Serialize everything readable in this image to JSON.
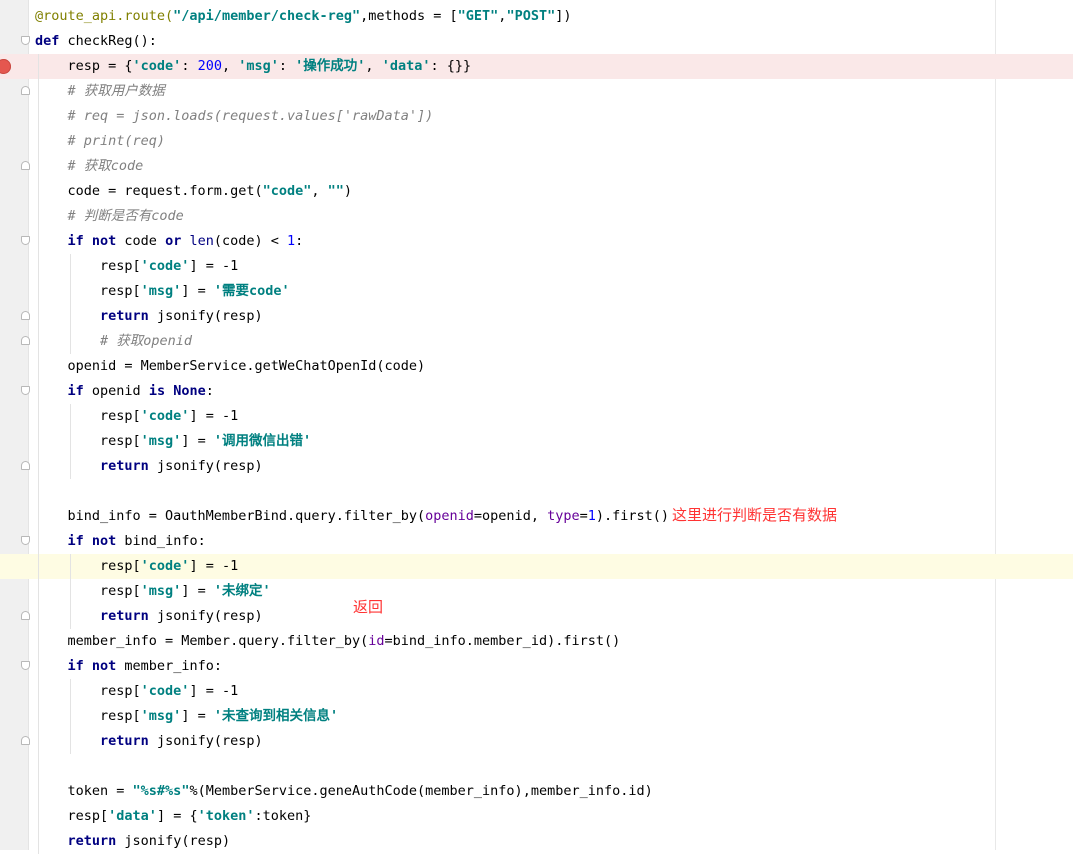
{
  "editor": {
    "lines": [
      [
        [
          "deco",
          "@route_api.route("
        ],
        [
          "str",
          "\"/api/member/check-reg\""
        ],
        [
          "plain",
          ",methods = ["
        ],
        [
          "str",
          "\"GET\""
        ],
        [
          "plain",
          ","
        ],
        [
          "str",
          "\"POST\""
        ],
        [
          "plain",
          "])"
        ]
      ],
      [
        [
          "kw",
          "def"
        ],
        [
          "plain",
          " checkReg():"
        ]
      ],
      [
        [
          "plain",
          "    resp = {"
        ],
        [
          "str",
          "'code'"
        ],
        [
          "plain",
          ": "
        ],
        [
          "num",
          "200"
        ],
        [
          "plain",
          ", "
        ],
        [
          "str",
          "'msg'"
        ],
        [
          "plain",
          ": "
        ],
        [
          "str",
          "'操作成功'"
        ],
        [
          "plain",
          ", "
        ],
        [
          "str",
          "'data'"
        ],
        [
          "plain",
          ": {}}"
        ]
      ],
      [
        [
          "cm",
          "    # 获取用户数据"
        ]
      ],
      [
        [
          "cm",
          "    # req = json.loads(request.values['rawData'])"
        ]
      ],
      [
        [
          "cm",
          "    # print(req)"
        ]
      ],
      [
        [
          "cm",
          "    # 获取code"
        ]
      ],
      [
        [
          "plain",
          "    code = request.form.get("
        ],
        [
          "str",
          "\"code\""
        ],
        [
          "plain",
          ", "
        ],
        [
          "str",
          "\"\""
        ],
        [
          "plain",
          ")"
        ]
      ],
      [
        [
          "cm",
          "    # 判断是否有code"
        ]
      ],
      [
        [
          "plain",
          "    "
        ],
        [
          "kw",
          "if not"
        ],
        [
          "plain",
          " code "
        ],
        [
          "kw",
          "or"
        ],
        [
          "plain",
          " "
        ],
        [
          "builtin",
          "len"
        ],
        [
          "plain",
          "(code) < "
        ],
        [
          "num",
          "1"
        ],
        [
          "plain",
          ":"
        ]
      ],
      [
        [
          "plain",
          "        resp["
        ],
        [
          "str",
          "'code'"
        ],
        [
          "plain",
          "] = -1"
        ]
      ],
      [
        [
          "plain",
          "        resp["
        ],
        [
          "str",
          "'msg'"
        ],
        [
          "plain",
          "] = "
        ],
        [
          "str",
          "'需要code'"
        ]
      ],
      [
        [
          "plain",
          "        "
        ],
        [
          "kw",
          "return"
        ],
        [
          "plain",
          " jsonify(resp)"
        ]
      ],
      [
        [
          "cm",
          "        # 获取openid"
        ]
      ],
      [
        [
          "plain",
          "    openid = MemberService.getWeChatOpenId(code)"
        ]
      ],
      [
        [
          "plain",
          "    "
        ],
        [
          "kw",
          "if"
        ],
        [
          "plain",
          " openid "
        ],
        [
          "kw",
          "is None"
        ],
        [
          "plain",
          ":"
        ]
      ],
      [
        [
          "plain",
          "        resp["
        ],
        [
          "str",
          "'code'"
        ],
        [
          "plain",
          "] = -1"
        ]
      ],
      [
        [
          "plain",
          "        resp["
        ],
        [
          "str",
          "'msg'"
        ],
        [
          "plain",
          "] = "
        ],
        [
          "str",
          "'调用微信出错'"
        ]
      ],
      [
        [
          "plain",
          "        "
        ],
        [
          "kw",
          "return"
        ],
        [
          "plain",
          " jsonify(resp)"
        ]
      ],
      [
        [
          "plain",
          ""
        ]
      ],
      [
        [
          "plain",
          "    bind_info = OauthMemberBind.query.filter_by("
        ],
        [
          "param",
          "openid"
        ],
        [
          "plain",
          "=openid, "
        ],
        [
          "param",
          "type"
        ],
        [
          "plain",
          "="
        ],
        [
          "num",
          "1"
        ],
        [
          "plain",
          ").first()"
        ]
      ],
      [
        [
          "plain",
          "    "
        ],
        [
          "kw",
          "if not"
        ],
        [
          "plain",
          " bind_info:"
        ]
      ],
      [
        [
          "plain",
          "        resp["
        ],
        [
          "str",
          "'code'"
        ],
        [
          "plain",
          "] = -1"
        ]
      ],
      [
        [
          "plain",
          "        resp["
        ],
        [
          "str",
          "'msg'"
        ],
        [
          "plain",
          "] = "
        ],
        [
          "str",
          "'未绑定'"
        ]
      ],
      [
        [
          "plain",
          "        "
        ],
        [
          "kw",
          "return"
        ],
        [
          "plain",
          " jsonify(resp)"
        ]
      ],
      [
        [
          "plain",
          "    member_info = Member.query.filter_by("
        ],
        [
          "param",
          "id"
        ],
        [
          "plain",
          "=bind_info.member_id).first()"
        ]
      ],
      [
        [
          "plain",
          "    "
        ],
        [
          "kw",
          "if not"
        ],
        [
          "plain",
          " member_info:"
        ]
      ],
      [
        [
          "plain",
          "        resp["
        ],
        [
          "str",
          "'code'"
        ],
        [
          "plain",
          "] = -1"
        ]
      ],
      [
        [
          "plain",
          "        resp["
        ],
        [
          "str",
          "'msg'"
        ],
        [
          "plain",
          "] = "
        ],
        [
          "str",
          "'未查询到相关信息'"
        ]
      ],
      [
        [
          "plain",
          "        "
        ],
        [
          "kw",
          "return"
        ],
        [
          "plain",
          " jsonify(resp)"
        ]
      ],
      [
        [
          "plain",
          ""
        ]
      ],
      [
        [
          "plain",
          "    token = "
        ],
        [
          "str",
          "\"%s#%s\""
        ],
        [
          "plain",
          "%(MemberService.geneAuthCode(member_info),member_info.id)"
        ]
      ],
      [
        [
          "plain",
          "    resp["
        ],
        [
          "str",
          "'data'"
        ],
        [
          "plain",
          "] = {"
        ],
        [
          "str",
          "'token'"
        ],
        [
          "plain",
          ":token}"
        ]
      ],
      [
        [
          "plain",
          "    "
        ],
        [
          "kw",
          "return"
        ],
        [
          "plain",
          " jsonify(resp)"
        ]
      ]
    ],
    "annotations": {
      "judge_note": "这里进行判断是否有数据",
      "return_note": "返回"
    },
    "colors": {
      "keyword": "#000080",
      "string": "#008080",
      "number": "#0000ff",
      "comment": "#808080",
      "decorator": "#808000",
      "annotation": "#ff3333",
      "breakpoint": "#e5574f",
      "breakpoint_line": "#fae8e8",
      "caret_line": "#fefce3"
    }
  }
}
